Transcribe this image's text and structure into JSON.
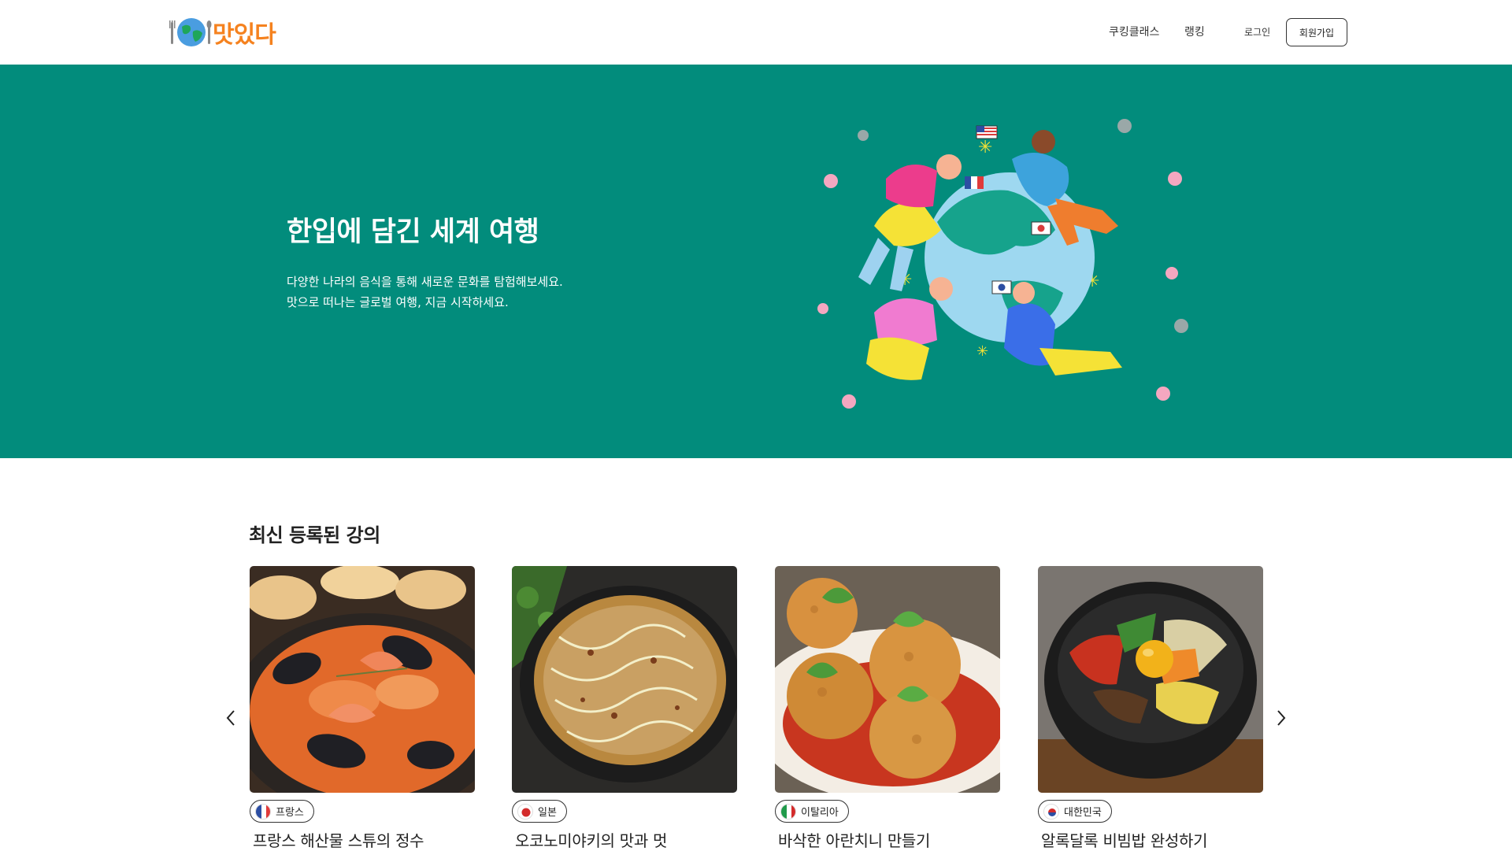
{
  "header": {
    "logo_text": "맛있다",
    "nav": [
      "쿠킹클래스",
      "랭킹"
    ],
    "login_label": "로그인",
    "signup_label": "회원가입"
  },
  "hero": {
    "title": "한입에 담긴 세계 여행",
    "subtitle_line1": "다양한 나라의 음식을 통해 새로운 문화를 탐험해보세요.",
    "subtitle_line2": "맛으로 떠나는 글로벌 여행, 지금 시작하세요."
  },
  "section": {
    "title": "최신 등록된 강의"
  },
  "cards": [
    {
      "country": "프랑스",
      "title": "프랑스 해산물 스튜의 정수",
      "image": "seafood-stew"
    },
    {
      "country": "일본",
      "title": "오코노미야키의 맛과 멋",
      "image": "okonomiyaki"
    },
    {
      "country": "이탈리아",
      "title": "바삭한 아란치니 만들기",
      "image": "arancini"
    },
    {
      "country": "대한민국",
      "title": "알록달록 비빔밥 완성하기",
      "image": "bibimbap"
    }
  ],
  "colors": {
    "hero_bg": "#028c7c",
    "logo": "#f5821f"
  },
  "icons": {
    "prev": "chevron-left-icon",
    "next": "chevron-right-icon"
  }
}
